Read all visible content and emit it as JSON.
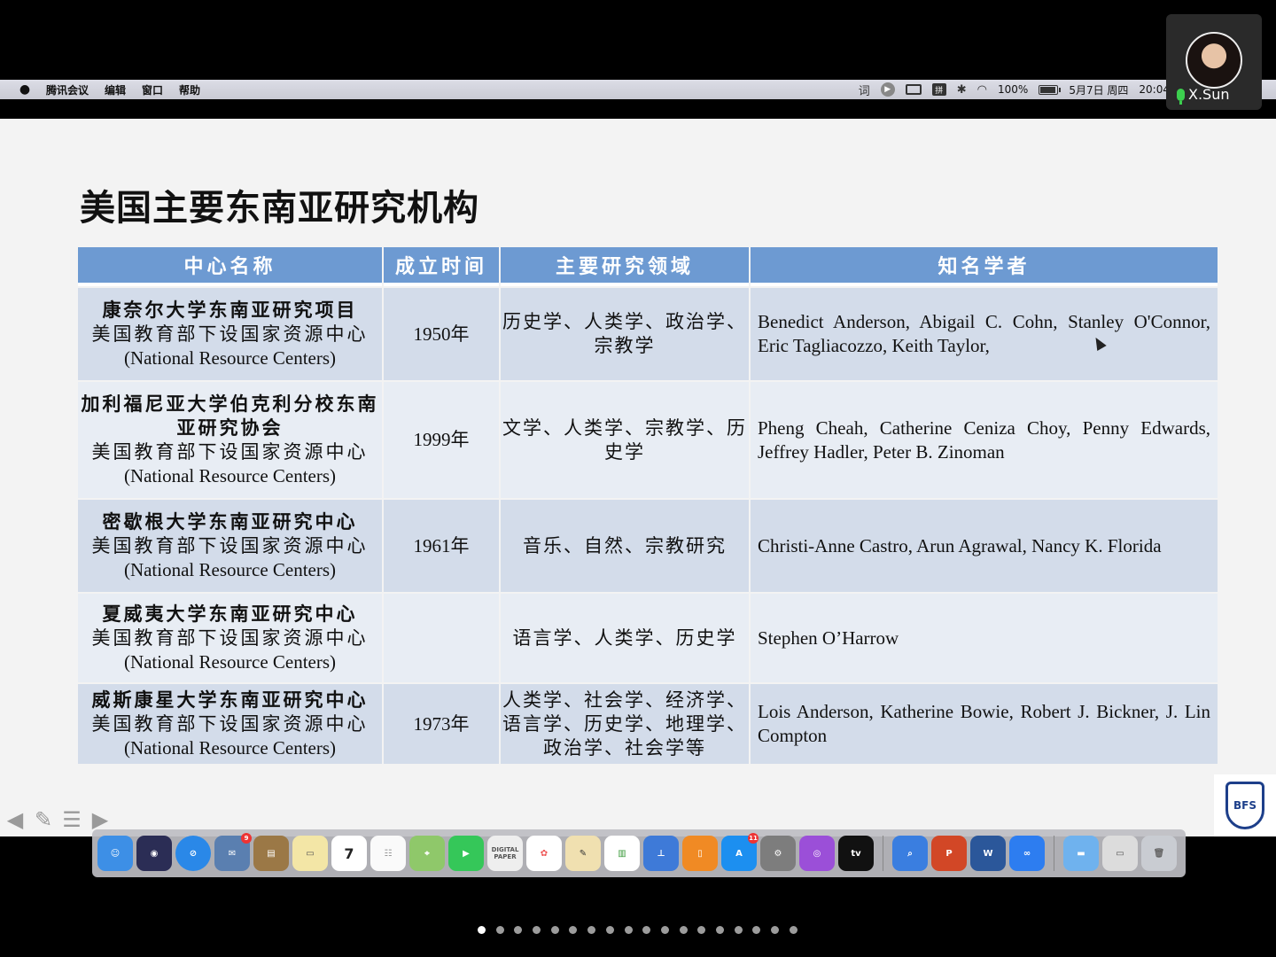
{
  "menubar": {
    "app_name": "腾讯会议",
    "menus": [
      "编辑",
      "窗口",
      "帮助"
    ],
    "status": {
      "dict_label": "词",
      "battery_percent": "100%",
      "battery_level": 1.0,
      "date": "5月7日 周四",
      "time": "20:04"
    }
  },
  "participant": {
    "name": "X.Sun"
  },
  "slide": {
    "title": "美国主要东南亚研究机构",
    "columns": [
      "中心名称",
      "成立时间",
      "主要研究领域",
      "知名学者"
    ],
    "rows": [
      {
        "name": "康奈尔大学东南亚研究项目",
        "sub_cn": "美国教育部下设国家资源中心",
        "sub_en": "(National Resource Centers)",
        "year": "1950年",
        "fields": "历史学、人类学、政治学、宗教学",
        "scholars": "Benedict Anderson, Abigail C. Cohn, Stanley O'Connor, Eric Tagliacozzo, Keith Taylor,"
      },
      {
        "name": "加利福尼亚大学伯克利分校东南亚研究协会",
        "sub_cn": "美国教育部下设国家资源中心",
        "sub_en": "(National Resource Centers)",
        "year": "1999年",
        "fields": "文学、人类学、宗教学、历史学",
        "scholars": "Pheng Cheah, Catherine Ceniza Choy, Penny Edwards, Jeffrey Hadler, Peter B. Zinoman"
      },
      {
        "name": "密歇根大学东南亚研究中心",
        "sub_cn": "美国教育部下设国家资源中心",
        "sub_en": "(National Resource Centers)",
        "year": "1961年",
        "fields": "音乐、自然、宗教研究",
        "scholars": "Christi-Anne Castro, Arun Agrawal, Nancy K. Florida"
      },
      {
        "name": "夏威夷大学东南亚研究中心",
        "sub_cn": "美国教育部下设国家资源中心",
        "sub_en": "(National Resource Centers)",
        "year": "",
        "fields": "语言学、人类学、历史学",
        "scholars": "Stephen O’Harrow"
      },
      {
        "name": "威斯康星大学东南亚研究中心",
        "sub_cn": "美国教育部下设国家资源中心",
        "sub_en": "(National Resource Centers)",
        "year": "1973年",
        "fields": "人类学、社会学、经济学、语言学、历史学、地理学、政治学、社会学等",
        "scholars": "Lois Anderson, Katherine Bowie, Robert J. Bickner, J. Lin Compton"
      }
    ],
    "logo_text": "BFS"
  },
  "dock": {
    "calendar_day": "7",
    "mail_badge": "9",
    "appstore_badge": "11",
    "paper_label": "DIGITAL PAPER",
    "tv_label": "tv",
    "ppt_label": "P",
    "word_label": "W"
  },
  "page_dots": {
    "count": 18,
    "active_index": 0
  },
  "colors": {
    "header_blue": "#6d9ad2",
    "row_odd": "#d3dcea",
    "row_even": "#e8edf4",
    "mic_green": "#3ccf4e"
  }
}
